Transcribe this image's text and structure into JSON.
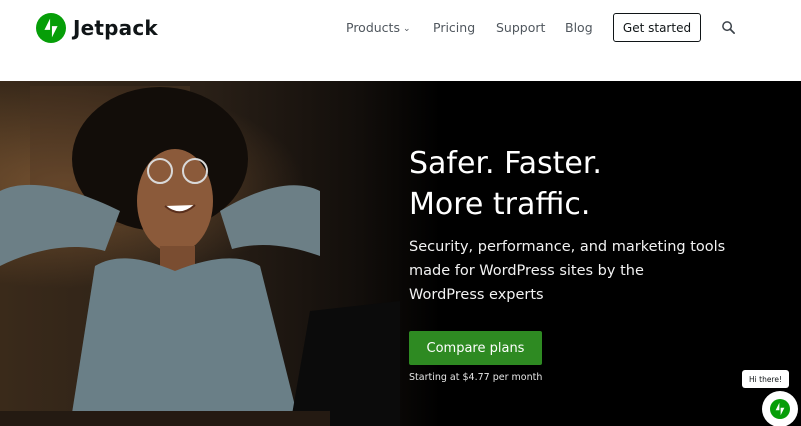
{
  "header": {
    "brand": "Jetpack",
    "nav": {
      "products": "Products",
      "pricing": "Pricing",
      "support": "Support",
      "blog": "Blog"
    },
    "cta_label": "Get started"
  },
  "hero": {
    "title_lines": [
      "Safer. Faster.",
      "More traffic."
    ],
    "subtitle_lines": [
      "Security, performance, and marketing tools",
      "made for WordPress sites by the",
      "WordPress experts"
    ],
    "button_label": "Compare plans",
    "price_note": "Starting at $4.77 per month"
  },
  "chat": {
    "greeting": "Hi there!"
  },
  "colors": {
    "brand_green": "#069e08",
    "button_green": "#2e8a22"
  },
  "icons": [
    "jetpack-logo-icon",
    "chevron-down-icon",
    "search-icon",
    "jetpack-chat-icon"
  ]
}
